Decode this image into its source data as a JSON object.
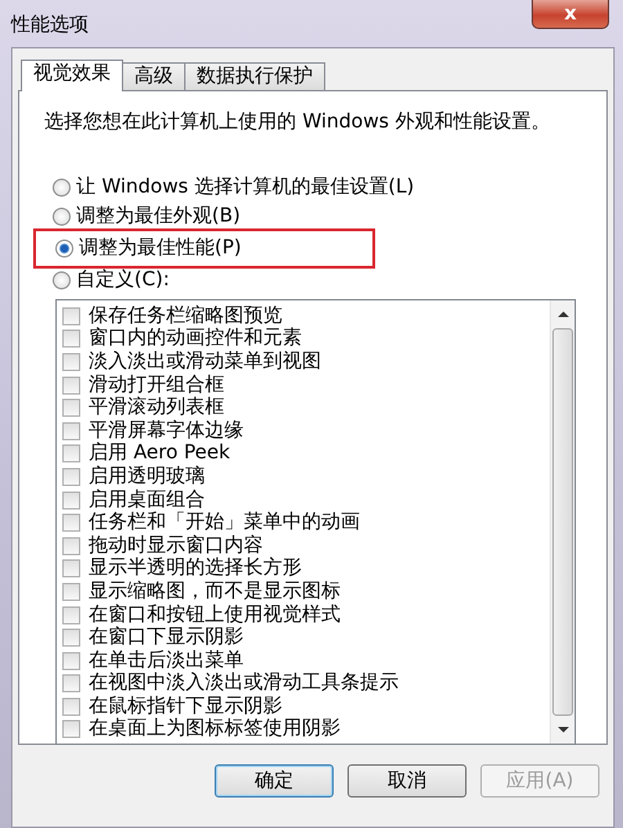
{
  "window": {
    "title": "性能选项",
    "close": "x"
  },
  "tabs": [
    {
      "label": "视觉效果",
      "selected": true
    },
    {
      "label": "高级",
      "selected": false
    },
    {
      "label": "数据执行保护",
      "selected": false
    }
  ],
  "description": "选择您想在此计算机上使用的 Windows 外观和性能设置。",
  "radios": [
    {
      "label": "让 Windows 选择计算机的最佳设置(L)",
      "selected": false,
      "highlighted": false
    },
    {
      "label": "调整为最佳外观(B)",
      "selected": false,
      "highlighted": false
    },
    {
      "label": "调整为最佳性能(P)",
      "selected": true,
      "highlighted": true
    },
    {
      "label": "自定义(C):",
      "selected": false,
      "highlighted": false
    }
  ],
  "options": [
    {
      "label": "保存任务栏缩略图预览",
      "checked": false
    },
    {
      "label": "窗口内的动画控件和元素",
      "checked": false
    },
    {
      "label": "淡入淡出或滑动菜单到视图",
      "checked": false
    },
    {
      "label": "滑动打开组合框",
      "checked": false
    },
    {
      "label": "平滑滚动列表框",
      "checked": false
    },
    {
      "label": "平滑屏幕字体边缘",
      "checked": false
    },
    {
      "label": "启用 Aero Peek",
      "checked": false
    },
    {
      "label": "启用透明玻璃",
      "checked": false
    },
    {
      "label": "启用桌面组合",
      "checked": false
    },
    {
      "label": "任务栏和「开始」菜单中的动画",
      "checked": false
    },
    {
      "label": "拖动时显示窗口内容",
      "checked": false
    },
    {
      "label": "显示半透明的选择长方形",
      "checked": false
    },
    {
      "label": "显示缩略图，而不是显示图标",
      "checked": false
    },
    {
      "label": "在窗口和按钮上使用视觉样式",
      "checked": false
    },
    {
      "label": "在窗口下显示阴影",
      "checked": false
    },
    {
      "label": "在单击后淡出菜单",
      "checked": false
    },
    {
      "label": "在视图中淡入淡出或滑动工具条提示",
      "checked": false
    },
    {
      "label": "在鼠标指针下显示阴影",
      "checked": false
    },
    {
      "label": "在桌面上为图标标签使用阴影",
      "checked": false
    }
  ],
  "buttons": [
    {
      "label": "确定",
      "disabled": false,
      "default": true
    },
    {
      "label": "取消",
      "disabled": false,
      "default": false
    },
    {
      "label": "应用(A)",
      "disabled": true,
      "default": false
    }
  ]
}
